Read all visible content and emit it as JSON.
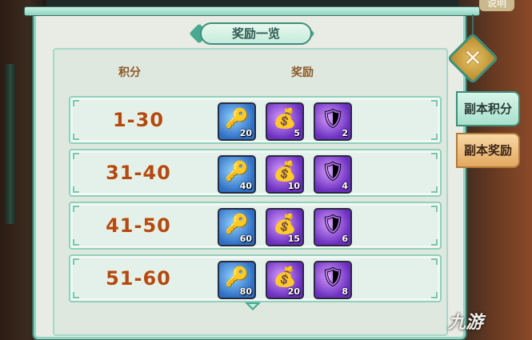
{
  "help_label": "说明",
  "title": "奖励一览",
  "columns": {
    "score": "积分",
    "reward": "奖励"
  },
  "rows": [
    {
      "range": "1-30",
      "rewards": [
        {
          "icon": "blue-orb-key-icon",
          "color": "#2f6fc4",
          "count": "20"
        },
        {
          "icon": "gold-treasure-chest-icon",
          "color": "#6a2fbf",
          "count": "5"
        },
        {
          "icon": "dark-armor-icon",
          "color": "#6a2fbf",
          "count": "2"
        }
      ]
    },
    {
      "range": "31-40",
      "rewards": [
        {
          "icon": "blue-orb-key-icon",
          "color": "#2f6fc4",
          "count": "40"
        },
        {
          "icon": "gold-treasure-chest-icon",
          "color": "#6a2fbf",
          "count": "10"
        },
        {
          "icon": "dark-armor-icon",
          "color": "#6a2fbf",
          "count": "4"
        }
      ]
    },
    {
      "range": "41-50",
      "rewards": [
        {
          "icon": "blue-orb-key-icon",
          "color": "#2f6fc4",
          "count": "60"
        },
        {
          "icon": "gold-treasure-chest-icon",
          "color": "#6a2fbf",
          "count": "15"
        },
        {
          "icon": "dark-armor-icon",
          "color": "#6a2fbf",
          "count": "6"
        }
      ]
    },
    {
      "range": "51-60",
      "rewards": [
        {
          "icon": "blue-orb-key-icon",
          "color": "#2f6fc4",
          "count": "80"
        },
        {
          "icon": "gold-treasure-chest-icon",
          "color": "#6a2fbf",
          "count": "20"
        },
        {
          "icon": "dark-armor-icon",
          "color": "#6a2fbf",
          "count": "8"
        }
      ]
    }
  ],
  "tabs": {
    "score": "副本积分",
    "reward": "副本奖励"
  },
  "watermark": "九游",
  "colors": {
    "range_text": "#b24a14",
    "panel_border": "#8fd3c0",
    "accent_teal": "#3d8f7a"
  }
}
